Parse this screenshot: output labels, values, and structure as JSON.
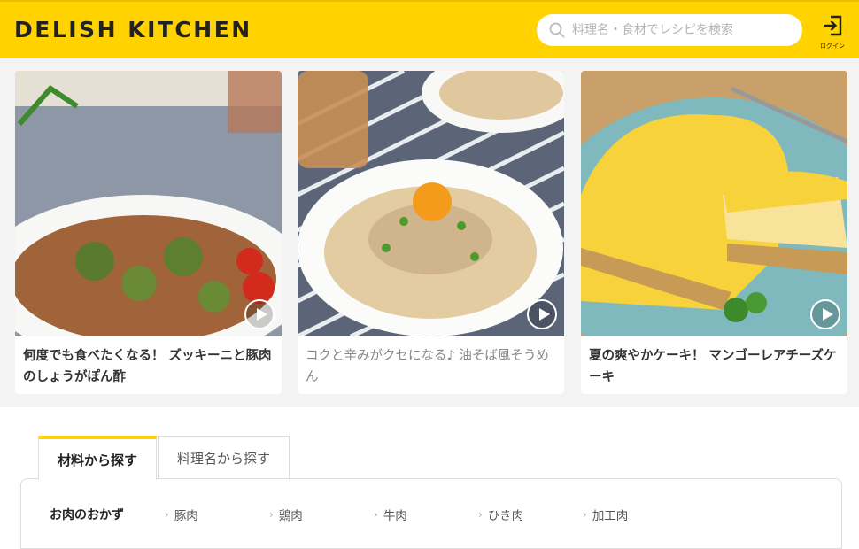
{
  "header": {
    "logo": "DELISH KITCHEN",
    "search_placeholder": "料理名・食材でレシピを検索",
    "login_label": "ログイン",
    "brand_color": "#ffd200"
  },
  "featured": [
    {
      "title": "何度でも食べたくなる！ ズッキーニと豚肉のしょうがぽん酢",
      "icon": "play-icon"
    },
    {
      "title": "コクと辛みがクセになる♪ 油そば風そうめん",
      "icon": "play-icon"
    },
    {
      "title": "夏の爽やかケーキ！ マンゴーレアチーズケーキ",
      "icon": "play-icon"
    }
  ],
  "tabs": [
    {
      "label": "材料から探す",
      "active": true
    },
    {
      "label": "料理名から探す",
      "active": false
    }
  ],
  "categories": {
    "heading": "お肉のおかず",
    "items": [
      "豚肉",
      "鶏肉",
      "牛肉",
      "ひき肉",
      "加工肉"
    ]
  }
}
